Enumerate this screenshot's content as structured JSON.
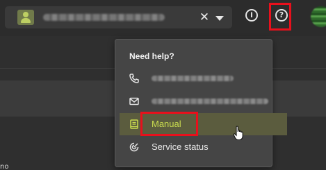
{
  "topbar": {
    "account_name": "",
    "clear_symbol": "✕",
    "info_symbol": "i",
    "help_symbol": "?"
  },
  "help_menu": {
    "title": "Need help?",
    "items": [
      {
        "icon": "phone-icon",
        "label": ""
      },
      {
        "icon": "mail-icon",
        "label": ""
      },
      {
        "icon": "book-icon",
        "label": "Manual",
        "selected": true
      },
      {
        "icon": "status-icon",
        "label": "Service status"
      }
    ]
  },
  "page": {
    "partial_text": "no"
  },
  "colors": {
    "accent": "#c9dc4f",
    "highlight_box": "#e8101c",
    "menu_background": "#454545",
    "selected_item": "#5b5c3e"
  }
}
